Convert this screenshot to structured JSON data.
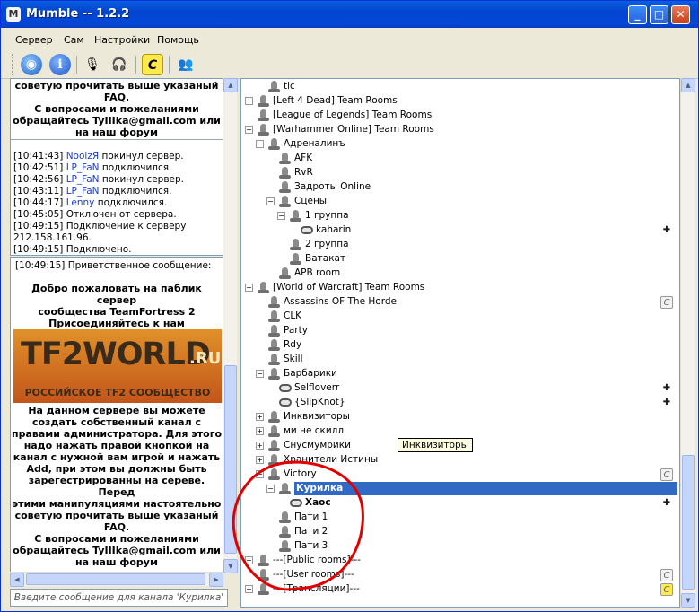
{
  "window": {
    "title": "Mumble -- 1.2.2"
  },
  "menu": [
    "Сервер",
    "Сам",
    "Настройки",
    "Помощь"
  ],
  "log_top": [
    "советую прочитать выше указаный",
    "FAQ.",
    "С вопросами и пожеланиями",
    "обращайтесь TyIIIka@gmail.com или",
    "на наш форум"
  ],
  "log": [
    {
      "time": "[10:41:43]",
      "nick": "NooizЯ",
      "text": "покинул сервер."
    },
    {
      "time": "[10:42:51]",
      "nick": "LP_FaN",
      "text": "подключился."
    },
    {
      "time": "[10:42:56]",
      "nick": "LP_FaN",
      "text": "покинул сервер."
    },
    {
      "time": "[10:43:11]",
      "nick": "LP_FaN",
      "text": "подключился."
    },
    {
      "time": "[10:44:17]",
      "nick": "Lenny",
      "text": "подключился."
    },
    {
      "time": "[10:45:05]",
      "nick": "",
      "text": "Отключен от сервера."
    },
    {
      "time": "[10:49:15]",
      "nick": "",
      "text": "Подключение к серверу"
    },
    {
      "time": "",
      "nick": "",
      "text": "212.158.161.96."
    },
    {
      "time": "[10:49:15]",
      "nick": "",
      "text": "Подключено."
    }
  ],
  "welcome": {
    "header": "[10:49:15] Приветственное сообщение:",
    "intro": [
      "Добро пожаловать на паблик сервер",
      "сообщества TeamFortress 2",
      "Присоединяйтесь к нам"
    ],
    "banner_logo": "TF2WORLD",
    "banner_ru": ".RU",
    "banner_sub": "РОССИЙСКОЕ TF2 СООБЩЕСТВО",
    "body": [
      "На данном сервере вы можете",
      "создать собственный канал с",
      "правами администратора. Для этого",
      "надо нажать правой кнопкой на",
      "канал с нужной вам игрой и нажать",
      "Add, при этом вы должны быть",
      "зарегестрированны на сереве. Перед",
      "этими манипуляциями настоятельно",
      "советую прочитать выше указаный",
      "FAQ.",
      "С вопросами и пожеланиями",
      "обращайтесь TyIIIka@gmail.com или",
      "на наш форум"
    ]
  },
  "input_placeholder": "Введите сообщение для канала 'Курилка'",
  "tree": [
    {
      "label": "tic",
      "indent": 1,
      "kind": "channel",
      "exp": ""
    },
    {
      "label": "[Left 4 Dead] Team Rooms",
      "indent": 0,
      "kind": "channel",
      "exp": "+"
    },
    {
      "label": "[League of Legends] Team Rooms",
      "indent": 0,
      "kind": "channel",
      "exp": ""
    },
    {
      "label": "[Warhammer Online] Team Rooms",
      "indent": 0,
      "kind": "channel",
      "exp": "-"
    },
    {
      "label": "Адреналинъ",
      "indent": 1,
      "kind": "channel",
      "exp": "-"
    },
    {
      "label": "AFK",
      "indent": 2,
      "kind": "channel",
      "exp": ""
    },
    {
      "label": "RvR",
      "indent": 2,
      "kind": "channel",
      "exp": ""
    },
    {
      "label": "Задроты Online",
      "indent": 2,
      "kind": "channel",
      "exp": ""
    },
    {
      "label": "Сцены",
      "indent": 2,
      "kind": "channel",
      "exp": "-"
    },
    {
      "label": "1 группа",
      "indent": 3,
      "kind": "channel",
      "exp": "-"
    },
    {
      "label": "kaharin",
      "indent": 4,
      "kind": "user",
      "exp": "",
      "right": "reg"
    },
    {
      "label": "2 группа",
      "indent": 3,
      "kind": "channel",
      "exp": ""
    },
    {
      "label": "Ватакат",
      "indent": 3,
      "kind": "channel",
      "exp": ""
    },
    {
      "label": "APB room",
      "indent": 2,
      "kind": "channel",
      "exp": ""
    },
    {
      "label": "[World of Warcraft] Team Rooms",
      "indent": 0,
      "kind": "channel",
      "exp": "-"
    },
    {
      "label": "Assassins OF The Horde",
      "indent": 1,
      "kind": "channel",
      "exp": "",
      "right": "c"
    },
    {
      "label": "CLK",
      "indent": 1,
      "kind": "channel",
      "exp": ""
    },
    {
      "label": "Party",
      "indent": 1,
      "kind": "channel",
      "exp": ""
    },
    {
      "label": "Rdy",
      "indent": 1,
      "kind": "channel",
      "exp": ""
    },
    {
      "label": "Skill",
      "indent": 1,
      "kind": "channel",
      "exp": ""
    },
    {
      "label": "Барбарики",
      "indent": 1,
      "kind": "channel",
      "exp": "-"
    },
    {
      "label": "Selfloverr",
      "indent": 2,
      "kind": "user",
      "exp": "",
      "right": "reg"
    },
    {
      "label": "{SlipKnot}",
      "indent": 2,
      "kind": "user",
      "exp": "",
      "right": "reg"
    },
    {
      "label": "Инквизиторы",
      "indent": 1,
      "kind": "channel",
      "exp": "+"
    },
    {
      "label": "ми не скилл",
      "indent": 1,
      "kind": "channel",
      "exp": "+"
    },
    {
      "label": "Снусмумрики",
      "indent": 1,
      "kind": "channel",
      "exp": "+"
    },
    {
      "label": "Хранители Истины",
      "indent": 1,
      "kind": "channel",
      "exp": "+"
    },
    {
      "label": "Victory",
      "indent": 1,
      "kind": "channel",
      "exp": "-",
      "right": "c"
    },
    {
      "label": "Курилка",
      "indent": 2,
      "kind": "channel",
      "exp": "-",
      "selected": true
    },
    {
      "label": "Хаос",
      "indent": 3,
      "kind": "user",
      "exp": "",
      "bold": true,
      "right": "reg"
    },
    {
      "label": "Пати 1",
      "indent": 2,
      "kind": "channel",
      "exp": ""
    },
    {
      "label": "Пати 2",
      "indent": 2,
      "kind": "channel",
      "exp": ""
    },
    {
      "label": "Пати 3",
      "indent": 2,
      "kind": "channel",
      "exp": ""
    },
    {
      "label": "---[Public rooms]---",
      "indent": 0,
      "kind": "channel",
      "exp": "+"
    },
    {
      "label": "---[User rooms]---",
      "indent": 0,
      "kind": "channel",
      "exp": "",
      "right": "c"
    },
    {
      "label": "---[Трансляции]---",
      "indent": 0,
      "kind": "channel",
      "exp": "+",
      "right": "cy"
    }
  ],
  "tooltip": "Инквизиторы"
}
